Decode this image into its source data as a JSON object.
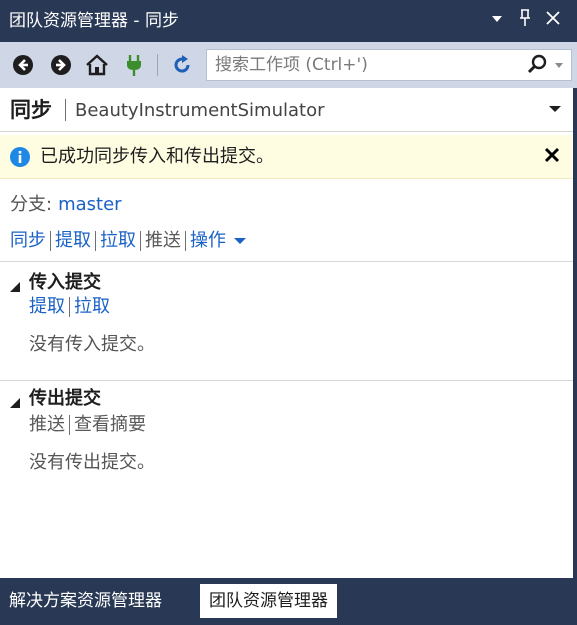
{
  "window": {
    "title": "团队资源管理器 - 同步"
  },
  "toolbar": {
    "search_placeholder": "搜索工作项 (Ctrl+')",
    "icons": [
      "back-icon",
      "forward-icon",
      "home-icon",
      "connect-icon",
      "refresh-icon",
      "search-icon"
    ]
  },
  "header": {
    "page_title": "同步",
    "repository": "BeautyInstrumentSimulator"
  },
  "info_bar": {
    "message": "已成功同步传入和传出提交。"
  },
  "branch": {
    "label": "分支:",
    "value": "master"
  },
  "actions": {
    "sync": "同步",
    "fetch": "提取",
    "pull": "拉取",
    "push": "推送",
    "more": "操作"
  },
  "incoming": {
    "title": "传入提交",
    "fetch": "提取",
    "pull": "拉取",
    "empty_message": "没有传入提交。"
  },
  "outgoing": {
    "title": "传出提交",
    "push": "推送",
    "view_summary": "查看摘要",
    "empty_message": "没有传出提交。"
  },
  "tabs": {
    "solution_explorer": "解决方案资源管理器",
    "team_explorer": "团队资源管理器"
  },
  "colors": {
    "chrome": "#293955",
    "toolbar": "#cfd6e5",
    "link": "#1a62c6",
    "info_bg": "#fffde1",
    "info_icon": "#1e88e5"
  }
}
